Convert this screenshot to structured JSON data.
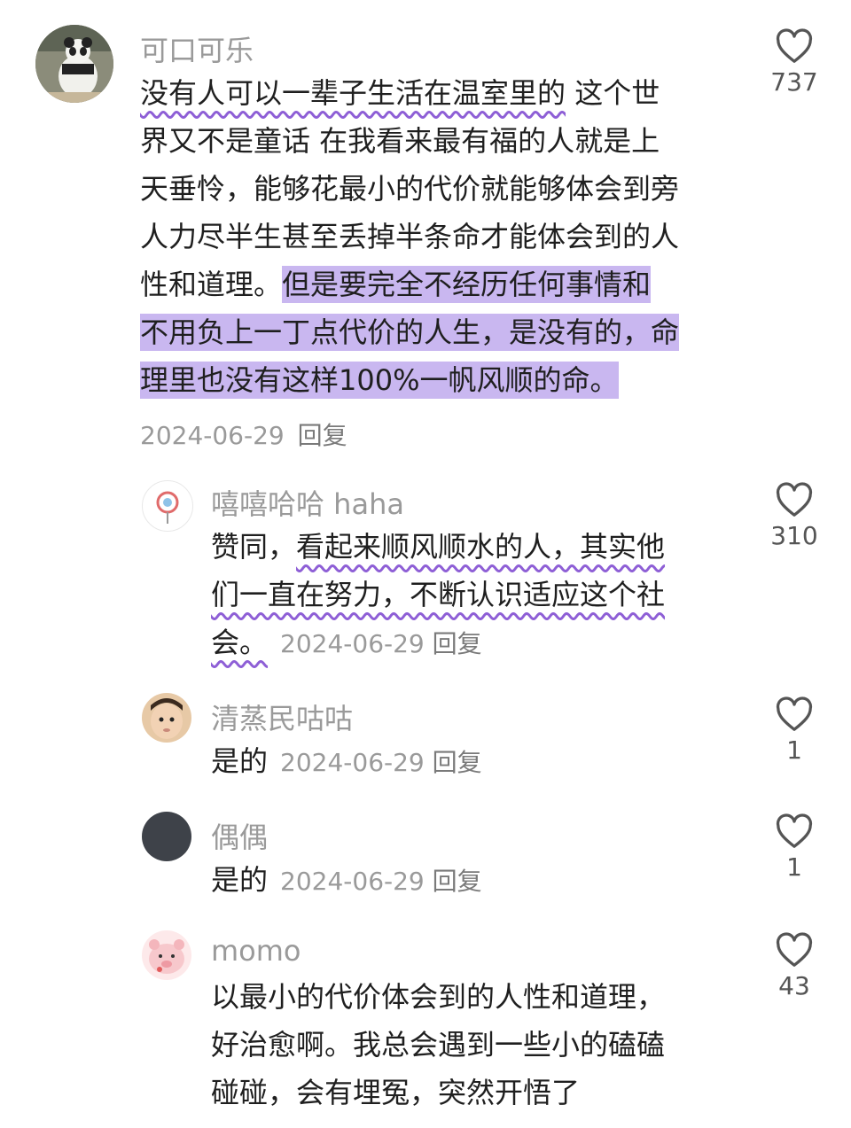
{
  "comments": [
    {
      "name": "可口可乐",
      "lines": [
        {
          "pre": "",
          "wavy": "没有人可以一辈子生活在温室里的",
          "post": " 这个世"
        },
        {
          "pre": "界又不是童话 在我看来最有福的人就是上",
          "wavy": "",
          "post": ""
        },
        {
          "pre": "天垂怜，能够花最小的代价就能够体会到旁",
          "wavy": "",
          "post": ""
        },
        {
          "pre": "人力尽半生甚至丢掉半条命才能体会到的人",
          "wavy": "",
          "post": ""
        },
        {
          "pre": "性和道理。",
          "hl": "但是要完全不经历任何事情和"
        },
        {
          "pre": "",
          "hl": "不用负上一丁点代价的人生，是没有的，命"
        },
        {
          "pre": "",
          "hl": "理里也没有这样100%一帆风顺的命。"
        }
      ],
      "date": "2024-06-29",
      "reply": "回复",
      "likes": "737"
    },
    {
      "name": "嘻嘻哈哈 haha",
      "lines": [
        {
          "pre": "赞同，",
          "wavy": "看起来顺风顺水的人，其实他",
          "post": ""
        },
        {
          "pre": "",
          "wavy": "们一直在努力，不断认识适应这个社",
          "post": ""
        }
      ],
      "last_wavy": "会。",
      "date": "2024-06-29",
      "reply": "回复",
      "likes": "310"
    },
    {
      "name": "清蒸民咕咕",
      "text": "是的",
      "date": "2024-06-29",
      "reply": "回复",
      "likes": "1"
    },
    {
      "name": "偶偶",
      "text": "是的",
      "date": "2024-06-29",
      "reply": "回复",
      "likes": "1"
    },
    {
      "name": "momo",
      "lines": [
        "以最小的代价体会到的人性和道理，",
        "好治愈啊。我总会遇到一些小的磕磕",
        "碰碰，会有埋冤，突然开悟了"
      ],
      "likes": "43"
    }
  ],
  "colors": {
    "highlight": "#c9b7f0",
    "wavy": "#8e5fd6",
    "secondary_text": "#9a9a9a"
  },
  "icons": {
    "like": "heart-outline-icon"
  }
}
